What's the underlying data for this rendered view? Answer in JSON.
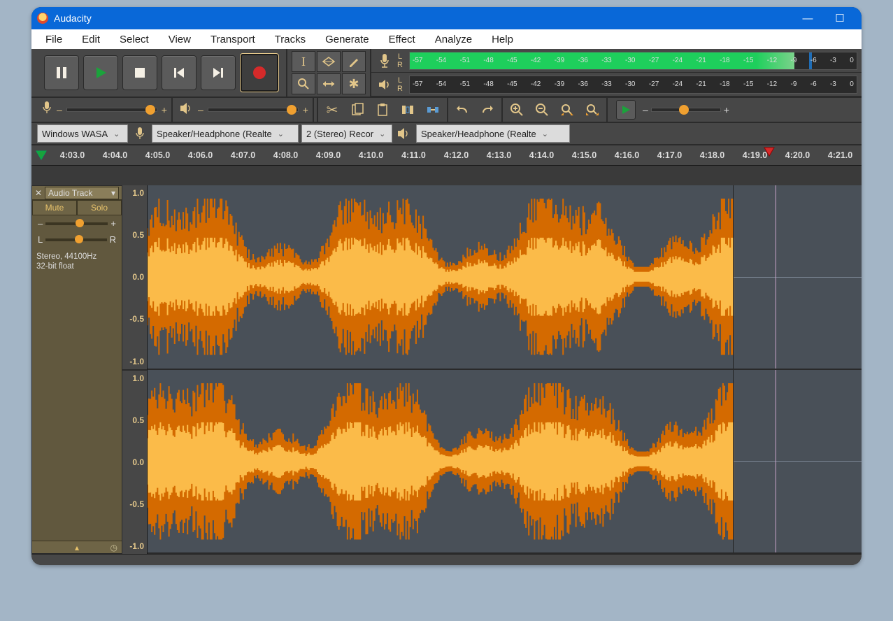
{
  "appTitle": "Audacity",
  "menus": [
    "File",
    "Edit",
    "Select",
    "View",
    "Transport",
    "Tracks",
    "Generate",
    "Effect",
    "Analyze",
    "Help"
  ],
  "meterTicks": [
    "-57",
    "-54",
    "-51",
    "-48",
    "-45",
    "-42",
    "-39",
    "-36",
    "-33",
    "-30",
    "-27",
    "-24",
    "-21",
    "-18",
    "-15",
    "-12",
    "-9",
    "-6",
    "-3",
    "0"
  ],
  "meterLR": {
    "l": "L",
    "r": "R"
  },
  "sliders": {
    "minus": "–",
    "plus": "+",
    "left": "L",
    "right": "R"
  },
  "devices": {
    "host": "Windows WASA",
    "recDevice": "Speaker/Headphone (Realte",
    "recChannels": "2 (Stereo) Recor",
    "playDevice": "Speaker/Headphone (Realte"
  },
  "timeline": [
    "4:03.0",
    "4:04.0",
    "4:05.0",
    "4:06.0",
    "4:07.0",
    "4:08.0",
    "4:09.0",
    "4:10.0",
    "4:11.0",
    "4:12.0",
    "4:13.0",
    "4:14.0",
    "4:15.0",
    "4:16.0",
    "4:17.0",
    "4:18.0",
    "4:19.0",
    "4:20.0",
    "4:21.0"
  ],
  "track": {
    "name": "Audio Track",
    "mute": "Mute",
    "solo": "Solo",
    "format1": "Stereo, 44100Hz",
    "format2": "32-bit float"
  },
  "ampScale": [
    "1.0",
    "0.5",
    "0.0",
    "-0.5",
    "-1.0"
  ]
}
